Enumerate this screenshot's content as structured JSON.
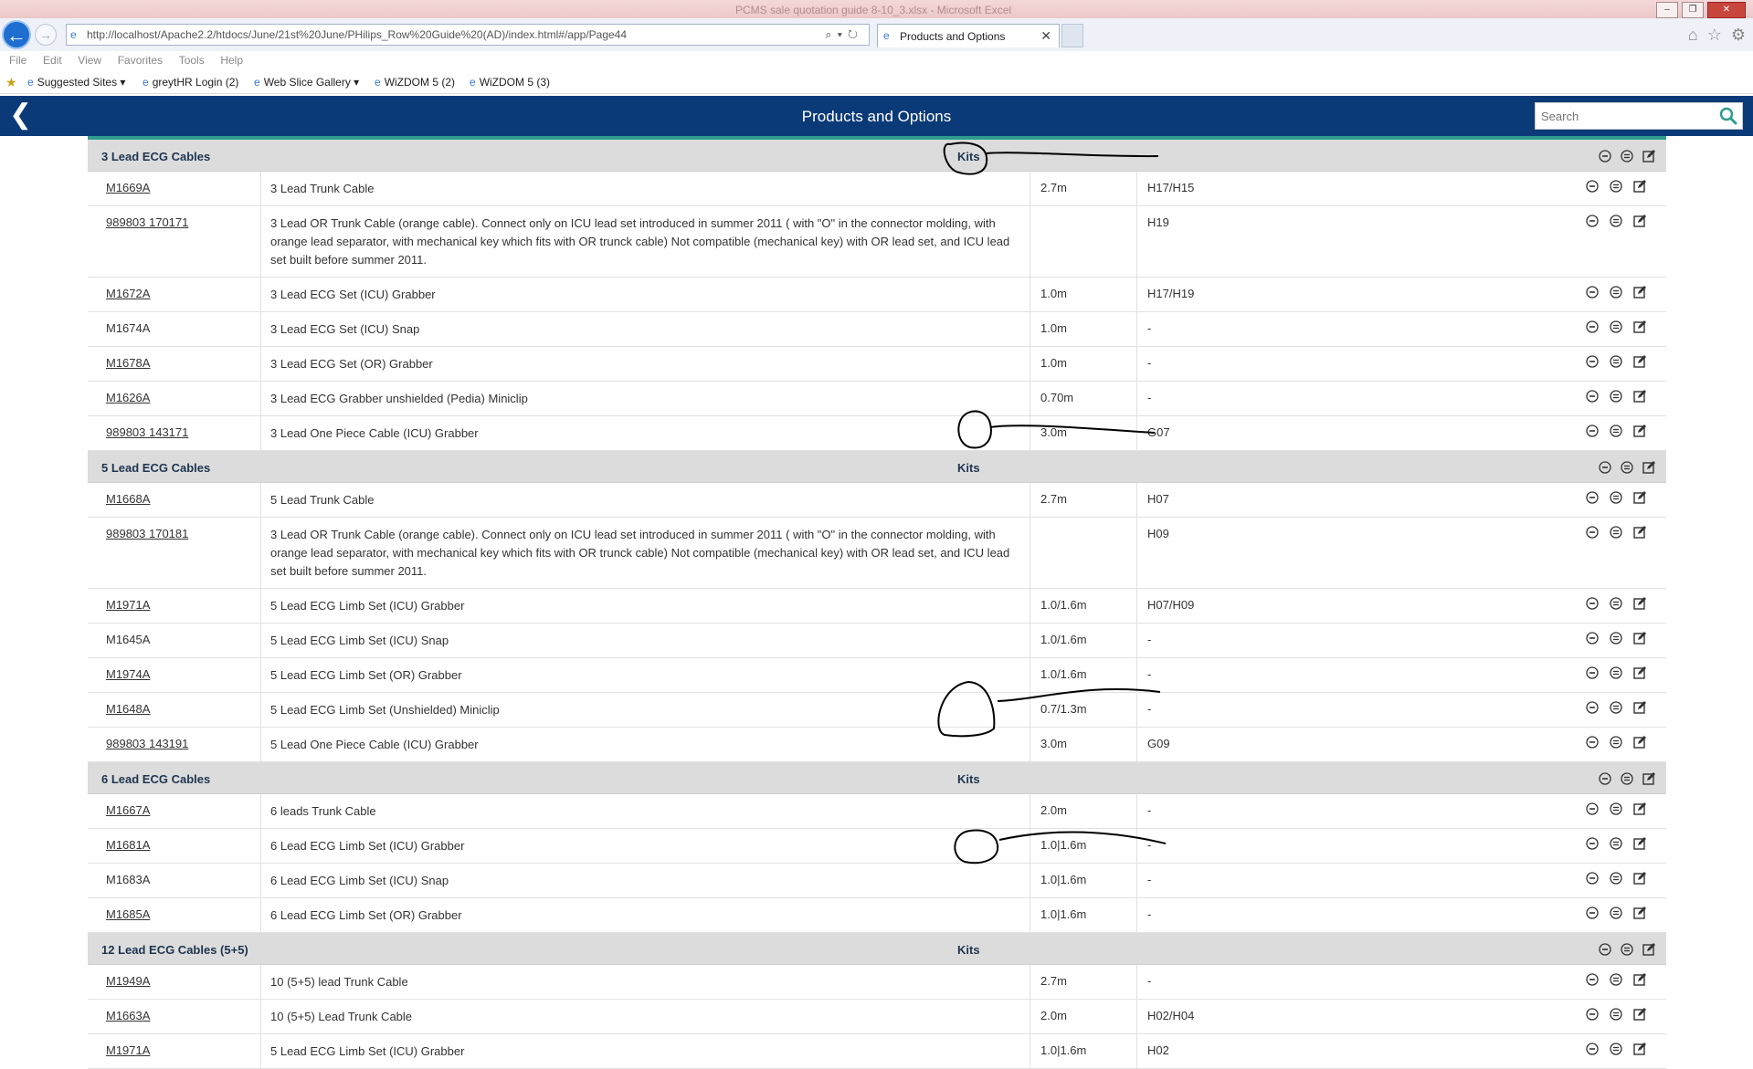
{
  "browser": {
    "window_title": "PCMS sale quotation guide 8-10_3.xlsx - Microsoft Excel",
    "url": "http://localhost/Apache2.2/htdocs/June/21st%20June/PHilips_Row%20Guide%20(AD)/index.html#/app/Page44",
    "tab_title": "Products and Options",
    "menu": [
      "File",
      "Edit",
      "View",
      "Favorites",
      "Tools",
      "Help"
    ],
    "favorites": [
      "Suggested Sites ▾",
      "greytHR Login (2)",
      "Web Slice Gallery ▾",
      "WiZDOM 5 (2)",
      "WiZDOM 5 (3)"
    ]
  },
  "header": {
    "title": "Products and Options",
    "search_placeholder": "Search"
  },
  "kits_label": "Kits",
  "sections": [
    {
      "title": "3 Lead ECG Cables",
      "rows": [
        {
          "code": "M1669A",
          "link": true,
          "desc": "3 Lead Trunk Cable",
          "length": "2.7m",
          "ref": "H17/H15"
        },
        {
          "code": "989803 170171",
          "link": true,
          "desc": "3 Lead OR Trunk Cable (orange cable). Connect only on ICU lead set introduced in summer 2011 ( with \"O\" in the connector molding, with orange lead separator, with mechanical key which fits with OR trunck cable) Not compatible (mechanical key) with OR lead set, and ICU lead set built before summer 2011.",
          "length": "",
          "ref": "H19"
        },
        {
          "code": "M1672A",
          "link": true,
          "desc": "3 Lead ECG Set (ICU) Grabber",
          "length": "1.0m",
          "ref": "H17/H19"
        },
        {
          "code": "M1674A",
          "link": false,
          "desc": "3 Lead ECG Set (ICU) Snap",
          "length": "1.0m",
          "ref": "-"
        },
        {
          "code": "M1678A",
          "link": true,
          "desc": "3 Lead ECG Set (OR) Grabber",
          "length": "1.0m",
          "ref": "-"
        },
        {
          "code": "M1626A",
          "link": true,
          "desc": "3 Lead ECG Grabber unshielded (Pedia) Miniclip",
          "length": "0.70m",
          "ref": "-"
        },
        {
          "code": "989803 143171",
          "link": true,
          "desc": "3 Lead One Piece Cable (ICU) Grabber",
          "length": "3.0m",
          "ref": "G07"
        }
      ]
    },
    {
      "title": "5 Lead ECG Cables",
      "rows": [
        {
          "code": "M1668A",
          "link": true,
          "desc": "5 Lead Trunk Cable",
          "length": "2.7m",
          "ref": "H07"
        },
        {
          "code": "989803 170181",
          "link": true,
          "desc": "3 Lead OR Trunk Cable (orange cable). Connect only on ICU lead set introduced in summer 2011 ( with \"O\" in the connector molding, with orange lead separator, with mechanical key which fits with OR trunck cable) Not compatible (mechanical key) with OR lead set, and ICU lead set built before summer 2011.",
          "length": "",
          "ref": "H09"
        },
        {
          "code": "M1971A",
          "link": true,
          "desc": "5 Lead ECG Limb Set (ICU) Grabber",
          "length": "1.0/1.6m",
          "ref": "H07/H09"
        },
        {
          "code": "M1645A",
          "link": false,
          "desc": "5 Lead ECG Limb Set (ICU) Snap",
          "length": "1.0/1.6m",
          "ref": "-"
        },
        {
          "code": "M1974A",
          "link": true,
          "desc": "5 Lead ECG Limb Set (OR) Grabber",
          "length": "1.0/1.6m",
          "ref": "-"
        },
        {
          "code": "M1648A",
          "link": true,
          "desc": "5 Lead ECG Limb Set (Unshielded) Miniclip",
          "length": "0.7/1.3m",
          "ref": "-"
        },
        {
          "code": "989803 143191",
          "link": true,
          "desc": "5 Lead One Piece Cable (ICU) Grabber",
          "length": "3.0m",
          "ref": "G09"
        }
      ]
    },
    {
      "title": "6 Lead ECG Cables",
      "rows": [
        {
          "code": "M1667A",
          "link": true,
          "desc": "6 leads Trunk Cable",
          "length": "2.0m",
          "ref": "-"
        },
        {
          "code": "M1681A",
          "link": true,
          "desc": "6 Lead ECG Limb Set (ICU) Grabber",
          "length": "1.0|1.6m",
          "ref": "-"
        },
        {
          "code": "M1683A",
          "link": false,
          "desc": "6 Lead ECG Limb Set (ICU) Snap",
          "length": "1.0|1.6m",
          "ref": "-"
        },
        {
          "code": "M1685A",
          "link": true,
          "desc": "6 Lead ECG Limb Set (OR) Grabber",
          "length": "1.0|1.6m",
          "ref": "-"
        }
      ]
    },
    {
      "title": "12 Lead ECG Cables (5+5)",
      "rows": [
        {
          "code": "M1949A",
          "link": true,
          "desc": "10 (5+5) lead Trunk Cable",
          "length": "2.7m",
          "ref": "-"
        },
        {
          "code": "M1663A",
          "link": true,
          "desc": "10 (5+5) Lead Trunk Cable",
          "length": "2.0m",
          "ref": "H02/H04"
        },
        {
          "code": "M1971A",
          "link": true,
          "desc": "5 Lead ECG Limb Set (ICU) Grabber",
          "length": "1.0|1.6m",
          "ref": "H02"
        }
      ]
    }
  ],
  "colors": {
    "header_bg": "#0b3a78",
    "accent": "#2e9c8f",
    "section_bg": "#dcdcdc",
    "section_title": "#1e3550"
  }
}
